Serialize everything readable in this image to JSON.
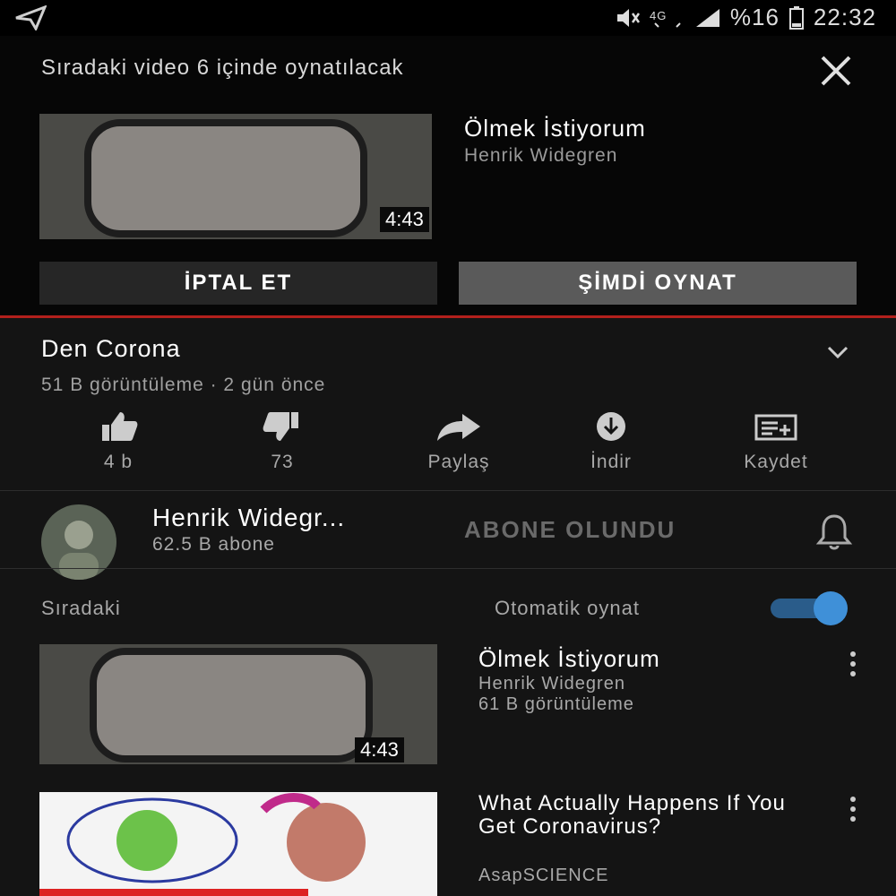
{
  "status_bar": {
    "battery": "%16",
    "time": "22:32",
    "icons": [
      "send-icon",
      "mute-icon",
      "network-icon",
      "signal-icon",
      "battery-icon"
    ]
  },
  "upnext_overlay": {
    "message": "Sıradaki video 6 içinde oynatılacak",
    "video_title": "Ölmek İstiyorum",
    "video_channel": "Henrik Widegren",
    "duration": "4:43",
    "cancel_label": "İPTAL ET",
    "play_now_label": "ŞİMDİ OYNAT"
  },
  "video": {
    "title": "Den Corona",
    "meta": "51 B görüntüleme · 2 gün önce"
  },
  "actions": [
    {
      "label": "4 b",
      "icon": "thumbs-up-icon"
    },
    {
      "label": "73",
      "icon": "thumbs-down-icon"
    },
    {
      "label": "Paylaş",
      "icon": "share-icon"
    },
    {
      "label": "İndir",
      "icon": "download-icon"
    },
    {
      "label": "Kaydet",
      "icon": "save-to-playlist-icon"
    }
  ],
  "channel": {
    "name": "Henrik Widegr...",
    "subscribers": "62.5 B abone",
    "subscribed_label": "ABONE OLUNDU"
  },
  "up_next": {
    "label": "Sıradaki",
    "autoplay_label": "Otomatik oynat",
    "autoplay_on": true,
    "items": [
      {
        "title": "Ölmek İstiyorum",
        "channel": "Henrik Widegren",
        "views": "61 B görüntüleme",
        "duration": "4:43"
      },
      {
        "title": "What Actually Happens If You Get Coronavirus?",
        "channel": "AsapSCIENCE"
      }
    ]
  },
  "colors": {
    "accent_red": "#b3201c",
    "toggle_blue": "#3f90d8"
  }
}
